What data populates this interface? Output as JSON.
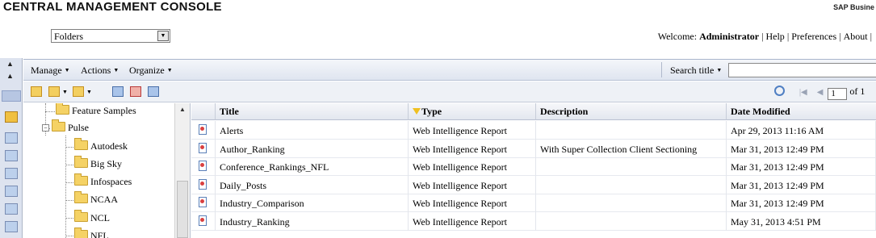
{
  "app": {
    "title": "CENTRAL MANAGEMENT CONSOLE",
    "brand": "SAP Busine"
  },
  "folder_select": {
    "value": "Folders"
  },
  "welcome": {
    "prefix": "Welcome: ",
    "user": "Administrator",
    "links": [
      "Help",
      "Preferences",
      "About"
    ],
    "trailing": "|"
  },
  "toolbar": {
    "menus": [
      "Manage",
      "Actions",
      "Organize"
    ],
    "search_label": "Search title",
    "page_value": "1",
    "page_of": "of 1"
  },
  "tree": {
    "items": [
      {
        "label": "Feature Samples",
        "level": 1
      },
      {
        "label": "Pulse",
        "level": 1,
        "expanded": true
      },
      {
        "label": "Autodesk",
        "level": 2
      },
      {
        "label": "Big Sky",
        "level": 2
      },
      {
        "label": "Infospaces",
        "level": 2
      },
      {
        "label": "NCAA",
        "level": 2
      },
      {
        "label": "NCL",
        "level": 2
      },
      {
        "label": "NFL",
        "level": 2
      }
    ]
  },
  "table": {
    "columns": [
      "Title",
      "Type",
      "Description",
      "Date Modified"
    ],
    "rows": [
      {
        "title": "Alerts",
        "type": "Web Intelligence Report",
        "description": "",
        "date": "Apr 29, 2013 11:16 AM"
      },
      {
        "title": "Author_Ranking",
        "type": "Web Intelligence Report",
        "description": "With Super Collection Client Sectioning",
        "date": "Mar 31, 2013 12:49 PM"
      },
      {
        "title": "Conference_Rankings_NFL",
        "type": "Web Intelligence Report",
        "description": "",
        "date": "Mar 31, 2013 12:49 PM"
      },
      {
        "title": "Daily_Posts",
        "type": "Web Intelligence Report",
        "description": "",
        "date": "Mar 31, 2013 12:49 PM"
      },
      {
        "title": "Industry_Comparison",
        "type": "Web Intelligence Report",
        "description": "",
        "date": "Mar 31, 2013 12:49 PM"
      },
      {
        "title": "Industry_Ranking",
        "type": "Web Intelligence Report",
        "description": "",
        "date": "May 31, 2013 4:51 PM"
      }
    ]
  }
}
